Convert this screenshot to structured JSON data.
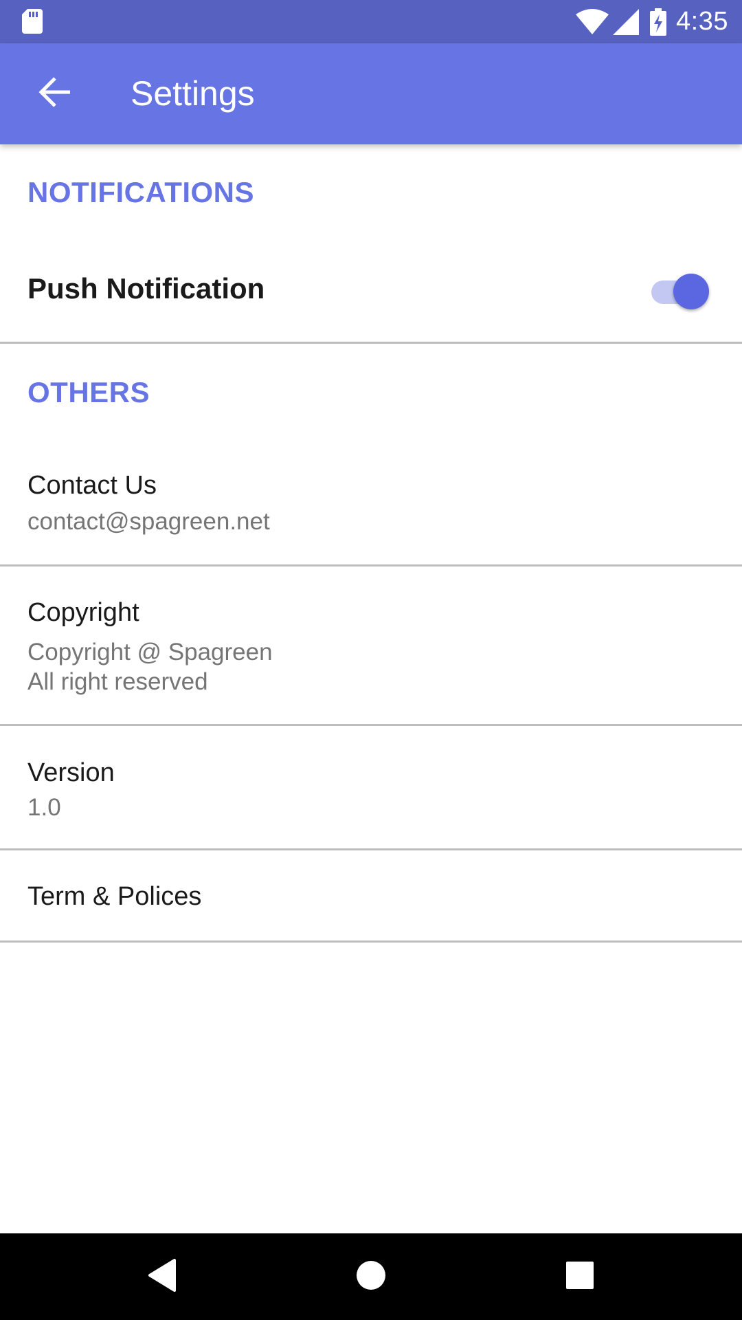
{
  "status_bar": {
    "time": "4:35",
    "icons": [
      "sd-card-icon",
      "wifi-icon",
      "signal-icon",
      "battery-charging-icon"
    ]
  },
  "app_bar": {
    "title": "Settings",
    "back_icon": "arrow-back-icon"
  },
  "notifications_section": {
    "header": "NOTIFICATIONS",
    "push_notification": {
      "label": "Push Notification",
      "enabled": true
    }
  },
  "others_section": {
    "header": "OTHERS",
    "items": [
      {
        "title": "Contact Us",
        "subtitle": "contact@spagreen.net"
      },
      {
        "title": "Copyright",
        "subtitle_line1": "Copyright @ Spagreen",
        "subtitle_line2": "All right reserved"
      },
      {
        "title": "Version",
        "subtitle": "1.0"
      },
      {
        "title": "Term & Polices"
      }
    ]
  },
  "nav_bar": {
    "icons": [
      "nav-back-icon",
      "nav-home-icon",
      "nav-recents-icon"
    ]
  },
  "colors": {
    "status_bar": "#5762c0",
    "app_bar": "#6774e4",
    "accent": "#6774e4",
    "switch_thumb": "#5a67e0",
    "switch_track": "#c3c8f3"
  }
}
